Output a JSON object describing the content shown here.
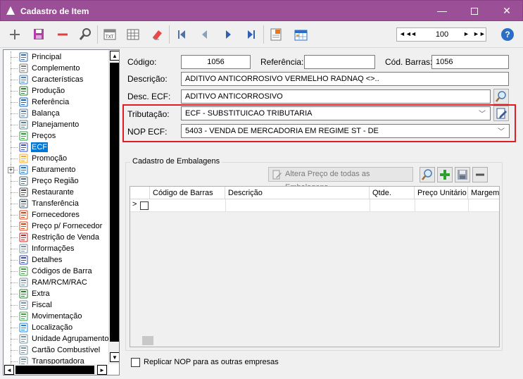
{
  "window": {
    "title": "Cadastro de Item",
    "min": "—",
    "close": "✕"
  },
  "toolbar": {
    "record_nav": {
      "first": "◄◄",
      "prev": "◄",
      "value": "100",
      "next": "►",
      "last": "►►"
    },
    "help": "?"
  },
  "tree": {
    "items": [
      {
        "label": "Principal",
        "icon": "list-icon",
        "color": "#3a6ea5"
      },
      {
        "label": "Complemento",
        "icon": "paperclip-icon",
        "color": "#7a7a7a"
      },
      {
        "label": "Características",
        "icon": "document-icon",
        "color": "#4a7fb5"
      },
      {
        "label": "Produção",
        "icon": "factory-icon",
        "color": "#2e7d32"
      },
      {
        "label": "Referência",
        "icon": "tree-icon",
        "color": "#1565c0"
      },
      {
        "label": "Balança",
        "icon": "scale-icon",
        "color": "#5d7aa0"
      },
      {
        "label": "Planejamento",
        "icon": "notepad-icon",
        "color": "#607d8b"
      },
      {
        "label": "Preços",
        "icon": "money-icon",
        "color": "#2e9d3a"
      },
      {
        "label": "ECF",
        "icon": "printer-icon",
        "color": "#3f51b5",
        "selected": true
      },
      {
        "label": "Promoção",
        "icon": "star-icon",
        "color": "#f9a825"
      },
      {
        "label": "Faturamento",
        "icon": "invoice-icon",
        "color": "#1976d2",
        "expander": "+"
      },
      {
        "label": "Preço Região",
        "icon": "map-icon",
        "color": "#546e7a"
      },
      {
        "label": "Restaurante",
        "icon": "restaurant-icon",
        "color": "#4a4a4a"
      },
      {
        "label": "Transferência",
        "icon": "transfer-icon",
        "color": "#455a64"
      },
      {
        "label": "Fornecedores",
        "icon": "people-icon",
        "color": "#d84315"
      },
      {
        "label": "Preço p/ Fornecedor",
        "icon": "people-icon",
        "color": "#d84315"
      },
      {
        "label": "Restrição de Venda",
        "icon": "people-icon",
        "color": "#c62828"
      },
      {
        "label": "Informações",
        "icon": "info-doc-icon",
        "color": "#78909c"
      },
      {
        "label": "Detalhes",
        "icon": "edit-icon",
        "color": "#3949ab"
      },
      {
        "label": "Códigos de Barra",
        "icon": "shapes-icon",
        "color": "#43a047"
      },
      {
        "label": "RAM/RCM/RAC",
        "icon": "document-icon",
        "color": "#78909c"
      },
      {
        "label": "Extra",
        "icon": "extra-icon",
        "color": "#2e7d32"
      },
      {
        "label": "Fiscal",
        "icon": "document-icon",
        "color": "#78909c"
      },
      {
        "label": "Movimentação",
        "icon": "chart-icon",
        "color": "#43a047"
      },
      {
        "label": "Localização",
        "icon": "location-icon",
        "color": "#1e88e5"
      },
      {
        "label": "Unidade Agrupamento",
        "icon": "document-icon",
        "color": "#78909c"
      },
      {
        "label": "Cartão Combustível",
        "icon": "document-icon",
        "color": "#78909c"
      },
      {
        "label": "Transportadora",
        "icon": "document-icon",
        "color": "#78909c"
      }
    ]
  },
  "form": {
    "codigo": {
      "label": "Código:",
      "value": "1056"
    },
    "referencia": {
      "label": "Referência:",
      "value": ""
    },
    "cod_barras": {
      "label": "Cód. Barras:",
      "value": "1056"
    },
    "descricao": {
      "label": "Descrição:",
      "value": "ADITIVO ANTICORROSIVO VERMELHO RADNAQ <>.."
    },
    "desc_ecf": {
      "label": "Desc. ECF:",
      "value": "ADITIVO ANTICORROSIVO"
    },
    "tributacao": {
      "label": "Tributação:",
      "value": "ECF - SUBSTITUICAO TRIBUTARIA"
    },
    "nop_ecf": {
      "label": "NOP ECF:",
      "value": "5403 - VENDA DE MERCADORIA EM REGIME ST - DE"
    }
  },
  "embalagens": {
    "legend": "Cadastro de Embalagens",
    "alter_button": "Altera Preço de todas as Embalagens",
    "columns": [
      "Código de Barras",
      "Descrição",
      "Qtde.",
      "Preço Unitário",
      "Margem"
    ],
    "row_indicator": ">"
  },
  "footer": {
    "replicar_label": "Replicar NOP para as outras empresas"
  },
  "colors": {
    "titlebar": "#9b4f96",
    "highlight_border": "#e01c24",
    "selection": "#0078d7"
  }
}
